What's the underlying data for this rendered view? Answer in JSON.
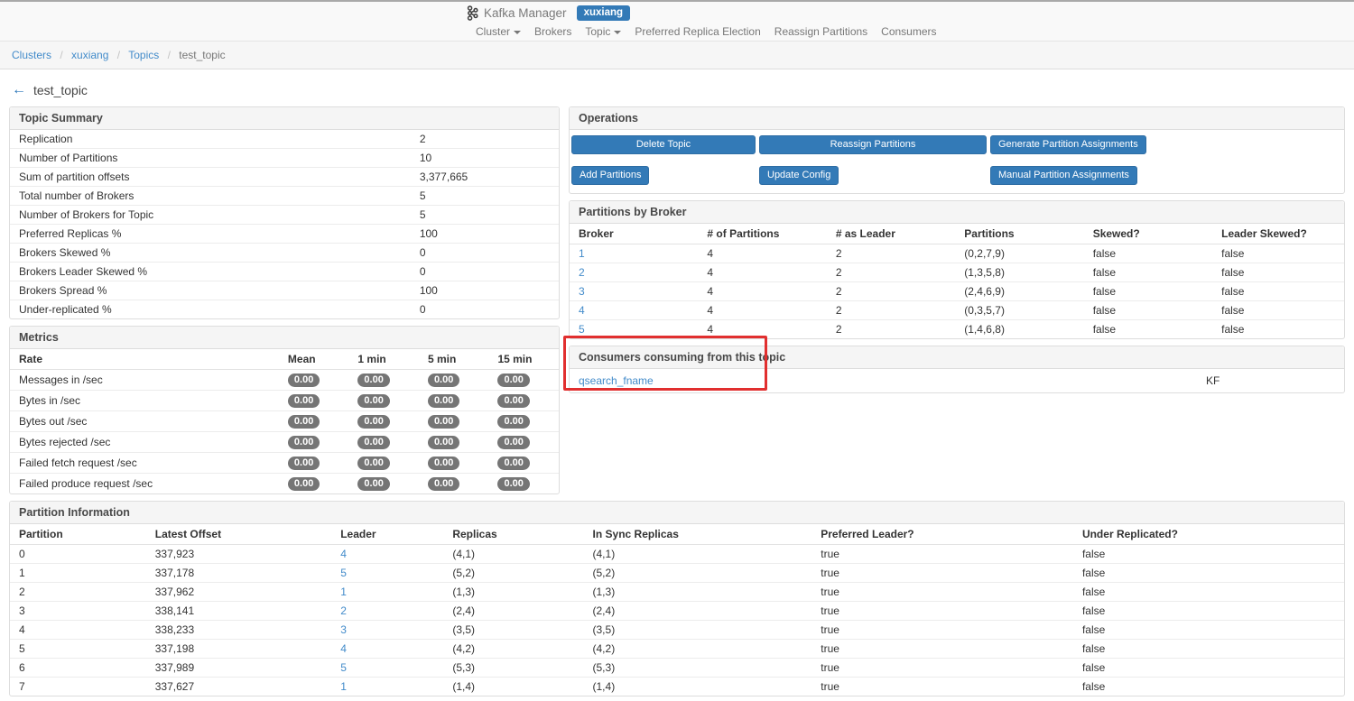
{
  "colors": {
    "accent": "#337ab7",
    "link": "#428bca",
    "badge_bg": "#757575",
    "annotation": "#e12f2f"
  },
  "navbar": {
    "brand": "Kafka Manager",
    "cluster_badge": "xuxiang",
    "items": [
      "Cluster",
      "Brokers",
      "Topic",
      "Preferred Replica Election",
      "Reassign Partitions",
      "Consumers"
    ]
  },
  "breadcrumb": {
    "links": [
      "Clusters",
      "xuxiang",
      "Topics"
    ],
    "current": "test_topic",
    "separator": "/"
  },
  "page": {
    "title": "test_topic"
  },
  "topic_summary": {
    "title": "Topic Summary",
    "rows": [
      {
        "label": "Replication",
        "value": "2"
      },
      {
        "label": "Number of Partitions",
        "value": "10"
      },
      {
        "label": "Sum of partition offsets",
        "value": "3,377,665"
      },
      {
        "label": "Total number of Brokers",
        "value": "5"
      },
      {
        "label": "Number of Brokers for Topic",
        "value": "5"
      },
      {
        "label": "Preferred Replicas %",
        "value": "100"
      },
      {
        "label": "Brokers Skewed %",
        "value": "0"
      },
      {
        "label": "Brokers Leader Skewed %",
        "value": "0"
      },
      {
        "label": "Brokers Spread %",
        "value": "100"
      },
      {
        "label": "Under-replicated %",
        "value": "0"
      }
    ]
  },
  "metrics": {
    "title": "Metrics",
    "headers": [
      "Rate",
      "Mean",
      "1 min",
      "5 min",
      "15 min"
    ],
    "rows": [
      {
        "label": "Messages in /sec",
        "values": [
          "0.00",
          "0.00",
          "0.00",
          "0.00"
        ]
      },
      {
        "label": "Bytes in /sec",
        "values": [
          "0.00",
          "0.00",
          "0.00",
          "0.00"
        ]
      },
      {
        "label": "Bytes out /sec",
        "values": [
          "0.00",
          "0.00",
          "0.00",
          "0.00"
        ]
      },
      {
        "label": "Bytes rejected /sec",
        "values": [
          "0.00",
          "0.00",
          "0.00",
          "0.00"
        ]
      },
      {
        "label": "Failed fetch request /sec",
        "values": [
          "0.00",
          "0.00",
          "0.00",
          "0.00"
        ]
      },
      {
        "label": "Failed produce request /sec",
        "values": [
          "0.00",
          "0.00",
          "0.00",
          "0.00"
        ]
      }
    ]
  },
  "operations": {
    "title": "Operations",
    "buttons": {
      "delete_topic": "Delete Topic",
      "reassign_partitions": "Reassign Partitions",
      "generate_partition_assignments": "Generate Partition Assignments",
      "add_partitions": "Add Partitions",
      "update_config": "Update Config",
      "manual_partition_assignments": "Manual Partition Assignments"
    }
  },
  "partitions_by_broker": {
    "title": "Partitions by Broker",
    "headers": [
      "Broker",
      "# of Partitions",
      "# as Leader",
      "Partitions",
      "Skewed?",
      "Leader Skewed?"
    ],
    "rows": [
      {
        "broker": "1",
        "num_partitions": "4",
        "as_leader": "2",
        "partitions": "(0,2,7,9)",
        "skewed": "false",
        "leader_skewed": "false"
      },
      {
        "broker": "2",
        "num_partitions": "4",
        "as_leader": "2",
        "partitions": "(1,3,5,8)",
        "skewed": "false",
        "leader_skewed": "false"
      },
      {
        "broker": "3",
        "num_partitions": "4",
        "as_leader": "2",
        "partitions": "(2,4,6,9)",
        "skewed": "false",
        "leader_skewed": "false"
      },
      {
        "broker": "4",
        "num_partitions": "4",
        "as_leader": "2",
        "partitions": "(0,3,5,7)",
        "skewed": "false",
        "leader_skewed": "false"
      },
      {
        "broker": "5",
        "num_partitions": "4",
        "as_leader": "2",
        "partitions": "(1,4,6,8)",
        "skewed": "false",
        "leader_skewed": "false"
      }
    ]
  },
  "consumers": {
    "title": "Consumers consuming from this topic",
    "rows": [
      {
        "name": "qsearch_fname",
        "type": "KF"
      }
    ]
  },
  "partition_information": {
    "title": "Partition Information",
    "headers": [
      "Partition",
      "Latest Offset",
      "Leader",
      "Replicas",
      "In Sync Replicas",
      "Preferred Leader?",
      "Under Replicated?"
    ],
    "rows": [
      {
        "partition": "0",
        "latest_offset": "337,923",
        "leader": "4",
        "replicas": "(4,1)",
        "in_sync_replicas": "(4,1)",
        "preferred_leader": "true",
        "under_replicated": "false"
      },
      {
        "partition": "1",
        "latest_offset": "337,178",
        "leader": "5",
        "replicas": "(5,2)",
        "in_sync_replicas": "(5,2)",
        "preferred_leader": "true",
        "under_replicated": "false"
      },
      {
        "partition": "2",
        "latest_offset": "337,962",
        "leader": "1",
        "replicas": "(1,3)",
        "in_sync_replicas": "(1,3)",
        "preferred_leader": "true",
        "under_replicated": "false"
      },
      {
        "partition": "3",
        "latest_offset": "338,141",
        "leader": "2",
        "replicas": "(2,4)",
        "in_sync_replicas": "(2,4)",
        "preferred_leader": "true",
        "under_replicated": "false"
      },
      {
        "partition": "4",
        "latest_offset": "338,233",
        "leader": "3",
        "replicas": "(3,5)",
        "in_sync_replicas": "(3,5)",
        "preferred_leader": "true",
        "under_replicated": "false"
      },
      {
        "partition": "5",
        "latest_offset": "337,198",
        "leader": "4",
        "replicas": "(4,2)",
        "in_sync_replicas": "(4,2)",
        "preferred_leader": "true",
        "under_replicated": "false"
      },
      {
        "partition": "6",
        "latest_offset": "337,989",
        "leader": "5",
        "replicas": "(5,3)",
        "in_sync_replicas": "(5,3)",
        "preferred_leader": "true",
        "under_replicated": "false"
      },
      {
        "partition": "7",
        "latest_offset": "337,627",
        "leader": "1",
        "replicas": "(1,4)",
        "in_sync_replicas": "(1,4)",
        "preferred_leader": "true",
        "under_replicated": "false"
      }
    ]
  }
}
